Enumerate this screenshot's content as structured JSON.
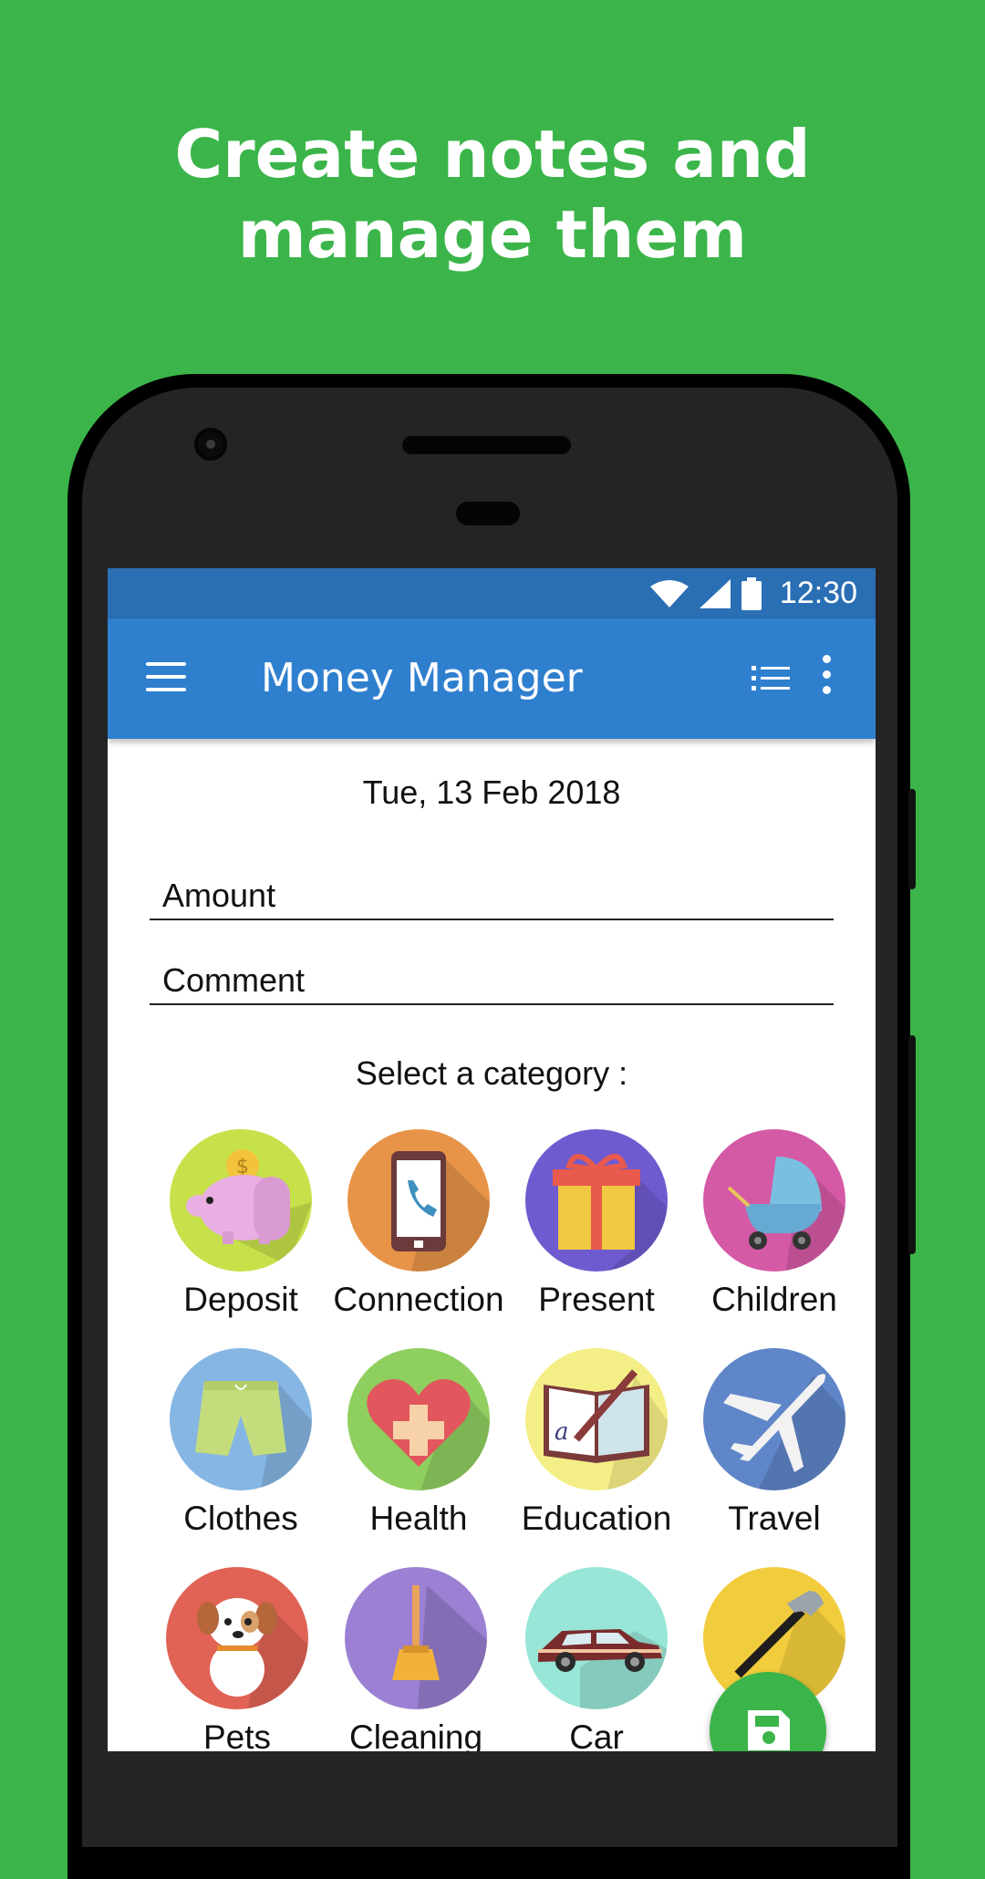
{
  "headline": {
    "line1": "Create notes and",
    "line2": "manage them"
  },
  "status_bar": {
    "time": "12:30",
    "icons": [
      "wifi-icon",
      "signal-icon",
      "battery-icon"
    ]
  },
  "app_bar": {
    "title": "Money Manager",
    "icons": [
      "menu-icon",
      "list-icon",
      "more-vert-icon"
    ]
  },
  "form": {
    "date": "Tue, 13 Feb 2018",
    "amount_placeholder": "Amount",
    "comment_placeholder": "Comment",
    "select_label": "Select a category :"
  },
  "categories": [
    {
      "label": "Deposit",
      "icon": "piggy-bank-icon",
      "color": "#c6e14a"
    },
    {
      "label": "Connection",
      "icon": "phone-icon",
      "color": "#e89448"
    },
    {
      "label": "Present",
      "icon": "gift-icon",
      "color": "#6f5bd0"
    },
    {
      "label": "Children",
      "icon": "stroller-icon",
      "color": "#d55aa6"
    },
    {
      "label": "Clothes",
      "icon": "shorts-icon",
      "color": "#86b6e3"
    },
    {
      "label": "Health",
      "icon": "heart-cross-icon",
      "color": "#8fcf60"
    },
    {
      "label": "Education",
      "icon": "book-pen-icon",
      "color": "#f4ee86"
    },
    {
      "label": "Travel",
      "icon": "airplane-icon",
      "color": "#5f86c8"
    },
    {
      "label": "Pets",
      "icon": "dog-icon",
      "color": "#e06355"
    },
    {
      "label": "Cleaning",
      "icon": "broom-icon",
      "color": "#9b80d4"
    },
    {
      "label": "Car",
      "icon": "car-icon",
      "color": "#98e6d8"
    },
    {
      "label": "",
      "icon": "hammer-icon",
      "color": "#f1cc3c"
    }
  ],
  "fab": {
    "icon": "save-icon",
    "color": "#3bb54a"
  },
  "colors": {
    "background": "#3bb54a",
    "status_bar": "#2a6eb4",
    "app_bar": "#2f7fcf"
  }
}
